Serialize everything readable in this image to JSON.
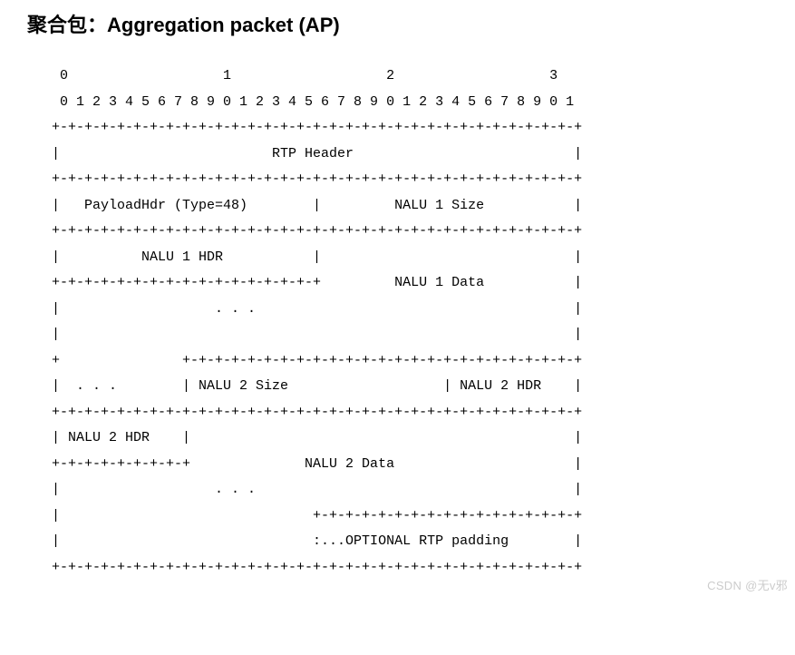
{
  "heading": "聚合包：Aggregation packet (AP)",
  "diagram": {
    "lines": [
      "    0                   1                   2                   3",
      "    0 1 2 3 4 5 6 7 8 9 0 1 2 3 4 5 6 7 8 9 0 1 2 3 4 5 6 7 8 9 0 1",
      "   +-+-+-+-+-+-+-+-+-+-+-+-+-+-+-+-+-+-+-+-+-+-+-+-+-+-+-+-+-+-+-+-+",
      "   |                          RTP Header                           |",
      "   +-+-+-+-+-+-+-+-+-+-+-+-+-+-+-+-+-+-+-+-+-+-+-+-+-+-+-+-+-+-+-+-+",
      "   |   PayloadHdr (Type=48)        |         NALU 1 Size           |",
      "   +-+-+-+-+-+-+-+-+-+-+-+-+-+-+-+-+-+-+-+-+-+-+-+-+-+-+-+-+-+-+-+-+",
      "   |          NALU 1 HDR           |                               |",
      "   +-+-+-+-+-+-+-+-+-+-+-+-+-+-+-+-+         NALU 1 Data           |",
      "   |                   . . .                                       |",
      "   |                                                               |",
      "   +               +-+-+-+-+-+-+-+-+-+-+-+-+-+-+-+-+-+-+-+-+-+-+-+-+",
      "   |  . . .        | NALU 2 Size                   | NALU 2 HDR    |",
      "   +-+-+-+-+-+-+-+-+-+-+-+-+-+-+-+-+-+-+-+-+-+-+-+-+-+-+-+-+-+-+-+-+",
      "   | NALU 2 HDR    |                                               |",
      "   +-+-+-+-+-+-+-+-+              NALU 2 Data                      |",
      "   |                   . . .                                       |",
      "   |                               +-+-+-+-+-+-+-+-+-+-+-+-+-+-+-+-+",
      "   |                               :...OPTIONAL RTP padding        |",
      "   +-+-+-+-+-+-+-+-+-+-+-+-+-+-+-+-+-+-+-+-+-+-+-+-+-+-+-+-+-+-+-+-+"
    ]
  },
  "watermark": "CSDN @无v邪"
}
